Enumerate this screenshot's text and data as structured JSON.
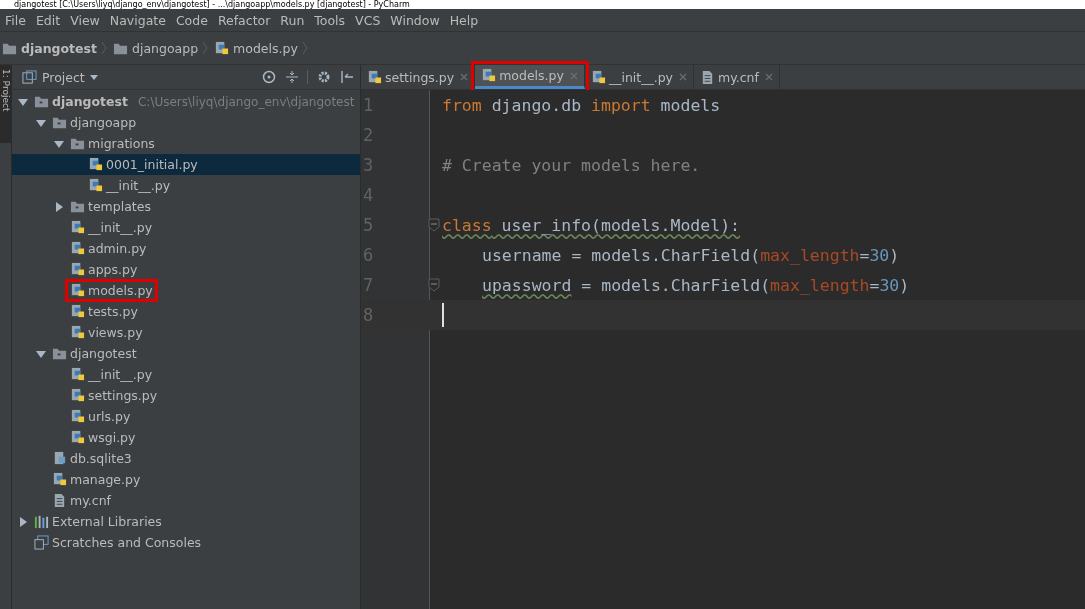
{
  "window": {
    "title": "djangotest [C:\\Users\\liyq\\django_env\\djangotest] - ...\\djangoapp\\models.py [djangotest] - PyCharm"
  },
  "menu": [
    "File",
    "Edit",
    "View",
    "Navigate",
    "Code",
    "Refactor",
    "Run",
    "Tools",
    "VCS",
    "Window",
    "Help"
  ],
  "breadcrumb": [
    {
      "label": "djangotest",
      "kind": "root"
    },
    {
      "label": "djangoapp",
      "kind": "folder"
    },
    {
      "label": "models.py",
      "kind": "python"
    }
  ],
  "side_strip": {
    "label": "1: Project"
  },
  "project_panel": {
    "title": "Project",
    "tree": [
      {
        "name": "djangotest",
        "kind": "root",
        "path": "C:\\Users\\liyq\\django_env\\djangotest",
        "expanded": true,
        "selected": false,
        "highlighted": false,
        "children": [
          {
            "name": "djangoapp",
            "kind": "folder",
            "expanded": true,
            "selected": false,
            "highlighted": false,
            "children": [
              {
                "name": "migrations",
                "kind": "folder",
                "expanded": true,
                "selected": false,
                "highlighted": false,
                "children": [
                  {
                    "name": "0001_initial.py",
                    "kind": "python",
                    "selected": true,
                    "highlighted": false
                  },
                  {
                    "name": "__init__.py",
                    "kind": "python",
                    "selected": false,
                    "highlighted": false
                  }
                ]
              },
              {
                "name": "templates",
                "kind": "folder",
                "expanded": false,
                "selected": false,
                "highlighted": false
              },
              {
                "name": "__init__.py",
                "kind": "python",
                "selected": false,
                "highlighted": false
              },
              {
                "name": "admin.py",
                "kind": "python",
                "selected": false,
                "highlighted": false
              },
              {
                "name": "apps.py",
                "kind": "python",
                "selected": false,
                "highlighted": false
              },
              {
                "name": "models.py",
                "kind": "python",
                "selected": false,
                "highlighted": true
              },
              {
                "name": "tests.py",
                "kind": "python",
                "selected": false,
                "highlighted": false
              },
              {
                "name": "views.py",
                "kind": "python",
                "selected": false,
                "highlighted": false
              }
            ]
          },
          {
            "name": "djangotest",
            "kind": "folder",
            "expanded": true,
            "selected": false,
            "highlighted": false,
            "children": [
              {
                "name": "__init__.py",
                "kind": "python",
                "selected": false,
                "highlighted": false
              },
              {
                "name": "settings.py",
                "kind": "python",
                "selected": false,
                "highlighted": false
              },
              {
                "name": "urls.py",
                "kind": "python",
                "selected": false,
                "highlighted": false
              },
              {
                "name": "wsgi.py",
                "kind": "python",
                "selected": false,
                "highlighted": false
              }
            ]
          },
          {
            "name": "db.sqlite3",
            "kind": "database",
            "selected": false,
            "highlighted": false
          },
          {
            "name": "manage.py",
            "kind": "python",
            "selected": false,
            "highlighted": false
          },
          {
            "name": "my.cnf",
            "kind": "text",
            "selected": false,
            "highlighted": false
          }
        ]
      },
      {
        "name": "External Libraries",
        "kind": "libraries",
        "expanded": false,
        "selected": false,
        "highlighted": false
      },
      {
        "name": "Scratches and Consoles",
        "kind": "scratches",
        "selected": false,
        "highlighted": false
      }
    ]
  },
  "tabs": [
    {
      "label": "settings.py",
      "kind": "python",
      "selected": false,
      "highlighted": false
    },
    {
      "label": "models.py",
      "kind": "python",
      "selected": true,
      "highlighted": true
    },
    {
      "label": "__init__.py",
      "kind": "python",
      "selected": false,
      "highlighted": false
    },
    {
      "label": "my.cnf",
      "kind": "text",
      "selected": false,
      "highlighted": false
    }
  ],
  "editor": {
    "lines": [
      {
        "number": "1",
        "fold": false,
        "current": false,
        "indented": false,
        "tokens": [
          {
            "text": "from",
            "kind": "keyword",
            "warning": false
          },
          {
            "text": " django.db ",
            "kind": "plain",
            "warning": false
          },
          {
            "text": "import",
            "kind": "keyword",
            "warning": false
          },
          {
            "text": " models",
            "kind": "plain",
            "warning": false
          }
        ]
      },
      {
        "number": "2",
        "fold": false,
        "current": false
      },
      {
        "number": "3",
        "fold": false,
        "current": false,
        "indented": false,
        "tokens": [
          {
            "text": "# Create your models here.",
            "kind": "comment",
            "warning": false
          }
        ]
      },
      {
        "number": "4",
        "fold": false,
        "current": false
      },
      {
        "number": "5",
        "fold": true,
        "current": false,
        "indented": false,
        "tokens": [
          {
            "text": "class",
            "kind": "keyword",
            "warning": true
          },
          {
            "text": " user_info(models.Model):",
            "kind": "plain",
            "warning": true
          }
        ]
      },
      {
        "number": "6",
        "fold": false,
        "current": false,
        "indented": true,
        "tokens": [
          {
            "text": "username = models.CharField(",
            "kind": "plain",
            "warning": false
          },
          {
            "text": "max_length",
            "kind": "param",
            "warning": false
          },
          {
            "text": "=",
            "kind": "plain",
            "warning": false
          },
          {
            "text": "30",
            "kind": "number",
            "warning": false
          },
          {
            "text": ")",
            "kind": "plain",
            "warning": false
          }
        ]
      },
      {
        "number": "7",
        "fold": true,
        "current": false,
        "indented": true,
        "tokens": [
          {
            "text": "upassword",
            "kind": "plain",
            "warning": true
          },
          {
            "text": " = models.CharField(",
            "kind": "plain",
            "warning": false
          },
          {
            "text": "max_length",
            "kind": "param",
            "warning": false
          },
          {
            "text": "=",
            "kind": "plain",
            "warning": false
          },
          {
            "text": "30",
            "kind": "number",
            "warning": false
          },
          {
            "text": ")",
            "kind": "plain",
            "warning": false
          }
        ]
      },
      {
        "number": "8",
        "fold": false,
        "current": true,
        "indented": false
      }
    ]
  }
}
